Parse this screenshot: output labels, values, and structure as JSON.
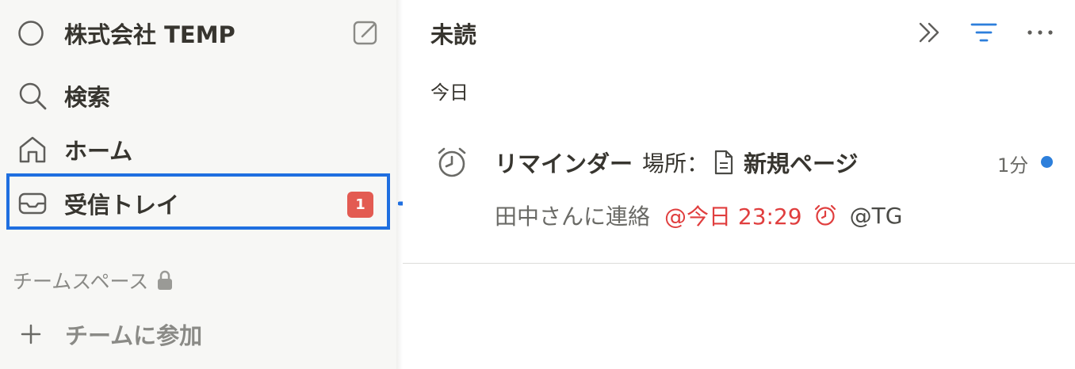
{
  "sidebar": {
    "workspace_name": "株式会社 TEMP",
    "items": [
      {
        "label": "検索",
        "icon": "search-icon"
      },
      {
        "label": "ホーム",
        "icon": "home-icon"
      },
      {
        "label": "受信トレイ",
        "icon": "inbox-icon",
        "badge": "1"
      }
    ],
    "section_title": "チームスペース",
    "join_label": "チームに参加"
  },
  "main": {
    "title": "未読",
    "group_label": "今日",
    "notification": {
      "title_prefix": "リマインダー",
      "location_label": "場所：",
      "page_name": "新規ページ",
      "time_ago": "1分",
      "body_text": "田中さんに連絡",
      "date_mention": "@今日 23:29",
      "user_mention": "@TG"
    }
  },
  "colors": {
    "highlight_border": "#1f6fe0",
    "badge_bg": "#e35b52",
    "unread_dot": "#2d7fdb",
    "reminder_red": "#e03e3e",
    "accent_blue": "#2d7fdb"
  }
}
